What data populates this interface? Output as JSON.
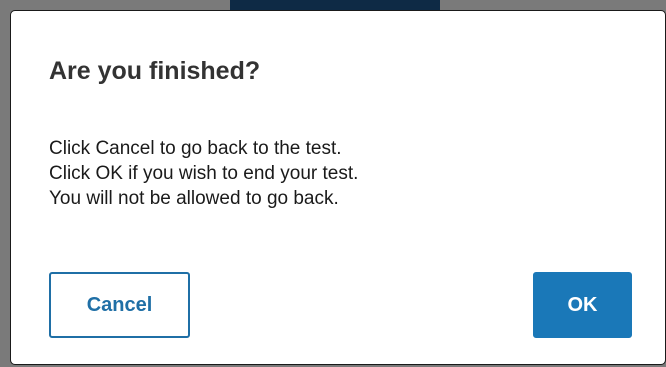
{
  "dialog": {
    "title": "Are you finished?",
    "message_lines": [
      "Click Cancel to go back to the test.",
      "Click OK if you wish to end your test.",
      "You will not be allowed to go back."
    ],
    "cancel_label": "Cancel",
    "ok_label": "OK"
  },
  "colors": {
    "overlay": "#7a7a7a",
    "background_strip": "#0e2a45",
    "accent": "#1a78b8",
    "cancel_text": "#1f6fa6",
    "title_text": "#333333"
  }
}
